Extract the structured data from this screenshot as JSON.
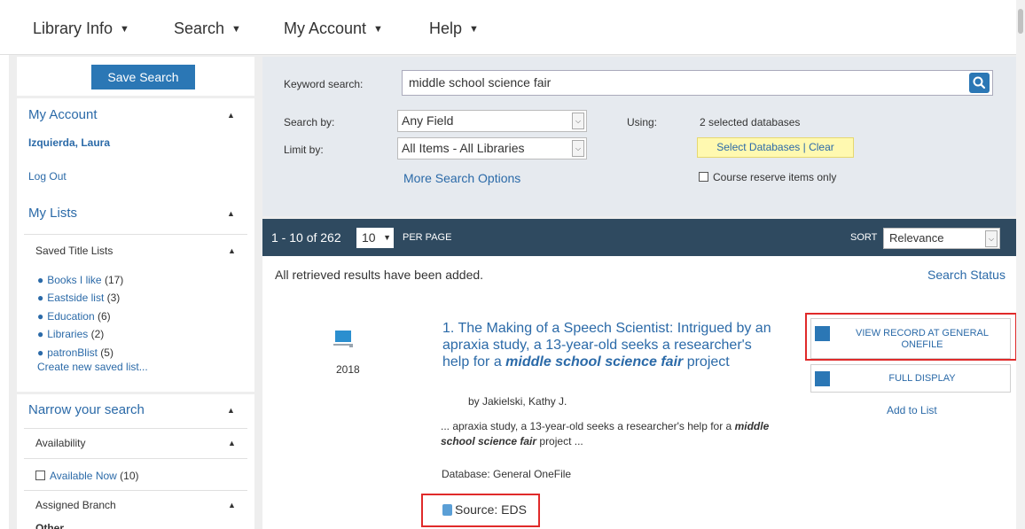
{
  "nav": {
    "library_info": "Library Info",
    "search": "Search",
    "my_account": "My Account",
    "help": "Help"
  },
  "sidebar": {
    "save_search": "Save Search",
    "my_account_title": "My Account",
    "user_name": "Izquierda, Laura",
    "log_out": "Log Out",
    "my_lists_title": "My Lists",
    "saved_title_lists": "Saved Title Lists",
    "lists": [
      {
        "name": "Books I like",
        "count": "(17)"
      },
      {
        "name": "Eastside list",
        "count": "(3)"
      },
      {
        "name": "Education",
        "count": "(6)"
      },
      {
        "name": "Libraries",
        "count": "(2)"
      },
      {
        "name": "patronBlist",
        "count": "(5)"
      }
    ],
    "create_list": "Create new saved list...",
    "narrow_title": "Narrow your search",
    "availability": "Availability",
    "available_now": "Available Now",
    "available_count": "(10)",
    "assigned_branch": "Assigned Branch",
    "other": "Other"
  },
  "search": {
    "keyword_label": "Keyword search:",
    "keyword_value": "middle school science fair",
    "search_by_label": "Search by:",
    "search_by_value": "Any Field",
    "limit_by_label": "Limit by:",
    "limit_by_value": "All Items - All Libraries",
    "more_options": "More Search Options",
    "using_label": "Using:",
    "using_value": "2 selected databases",
    "select_databases": "Select Databases",
    "clear": "Clear",
    "course_reserve": "Course reserve items only"
  },
  "results_bar": {
    "range": "1 - 10 of 262",
    "per_page_value": "10",
    "per_page_label": "PER PAGE",
    "sort_label": "SORT",
    "sort_value": "Relevance"
  },
  "results": {
    "status_msg": "All retrieved results have been added.",
    "search_status": "Search Status",
    "item": {
      "number": "1.",
      "title_plain": "The Making of a Speech Scientist: Intrigued by an apraxia study, a 13-year-old seeks a researcher's help for a",
      "title_em": "middle school science fair",
      "title_tail": "project",
      "author": "by Jakielski, Kathy J.",
      "year": "2018",
      "snippet_plain": "... apraxia study, a 13-year-old seeks a researcher's help for a",
      "snippet_em": "middle school science fair",
      "snippet_tail": "project ...",
      "database": "Database: General OneFile",
      "source": "Source: EDS",
      "view_record": "VIEW RECORD AT GENERAL ONEFILE",
      "full_display": "FULL DISPLAY",
      "add_to_list": "Add to List"
    }
  },
  "colors": {
    "accent": "#2b77b5",
    "link": "#2b6aa8",
    "results_bar": "#2f4a60",
    "highlight_box": "#e02a2a"
  }
}
